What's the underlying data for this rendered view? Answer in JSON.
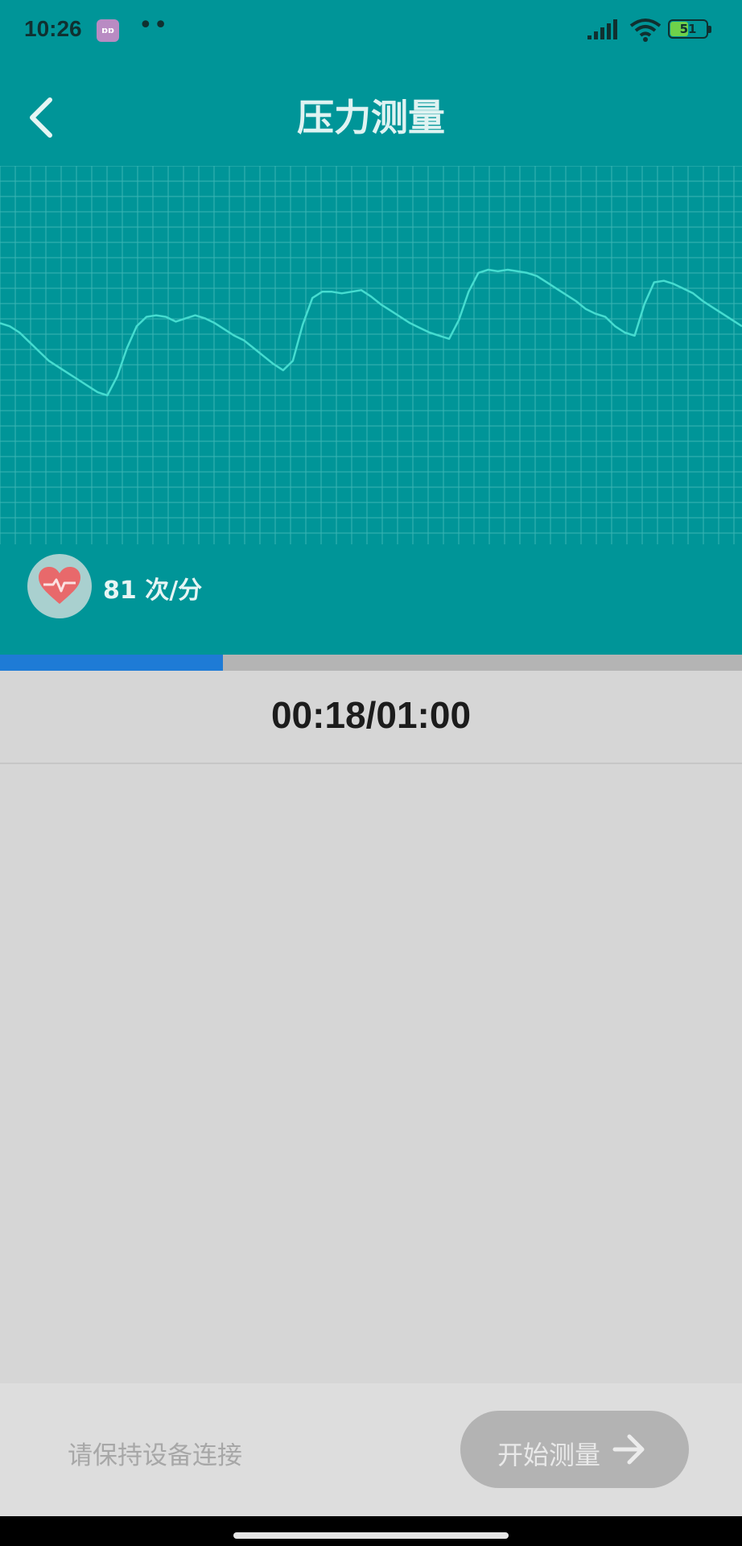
{
  "status_bar": {
    "time": "10:26",
    "app_icon_text": "ɒɒ",
    "dots": "••",
    "battery": "51",
    "battery_level": 0.51
  },
  "header": {
    "title": "压力测量",
    "back_icon": "chevron-left-icon"
  },
  "waveform": {
    "line_color": "#45dcd0",
    "grid_color": "#3bb5b4",
    "samples": [
      0.46,
      0.44,
      0.4,
      0.34,
      0.28,
      0.22,
      0.18,
      0.14,
      0.1,
      0.06,
      0.02,
      0.0,
      0.12,
      0.3,
      0.44,
      0.5,
      0.51,
      0.5,
      0.47,
      0.49,
      0.51,
      0.49,
      0.46,
      0.42,
      0.38,
      0.35,
      0.3,
      0.25,
      0.2,
      0.16,
      0.22,
      0.45,
      0.62,
      0.66,
      0.66,
      0.65,
      0.66,
      0.67,
      0.63,
      0.58,
      0.54,
      0.5,
      0.46,
      0.43,
      0.4,
      0.38,
      0.36,
      0.48,
      0.66,
      0.78,
      0.8,
      0.79,
      0.8,
      0.79,
      0.78,
      0.76,
      0.72,
      0.68,
      0.64,
      0.6,
      0.55,
      0.52,
      0.5,
      0.44,
      0.4,
      0.38,
      0.58,
      0.72,
      0.73,
      0.71,
      0.68,
      0.65,
      0.6,
      0.56,
      0.52,
      0.48,
      0.44
    ]
  },
  "heart_rate": {
    "icon": "heart-pulse-icon",
    "text": "81 次/分"
  },
  "progress": {
    "fraction": 0.3,
    "color": "#1e7bd6"
  },
  "timer": "00:18/01:00",
  "footer": {
    "hint": "请保持设备连接",
    "start_label": "开始测量",
    "start_icon": "arrow-right-icon"
  }
}
